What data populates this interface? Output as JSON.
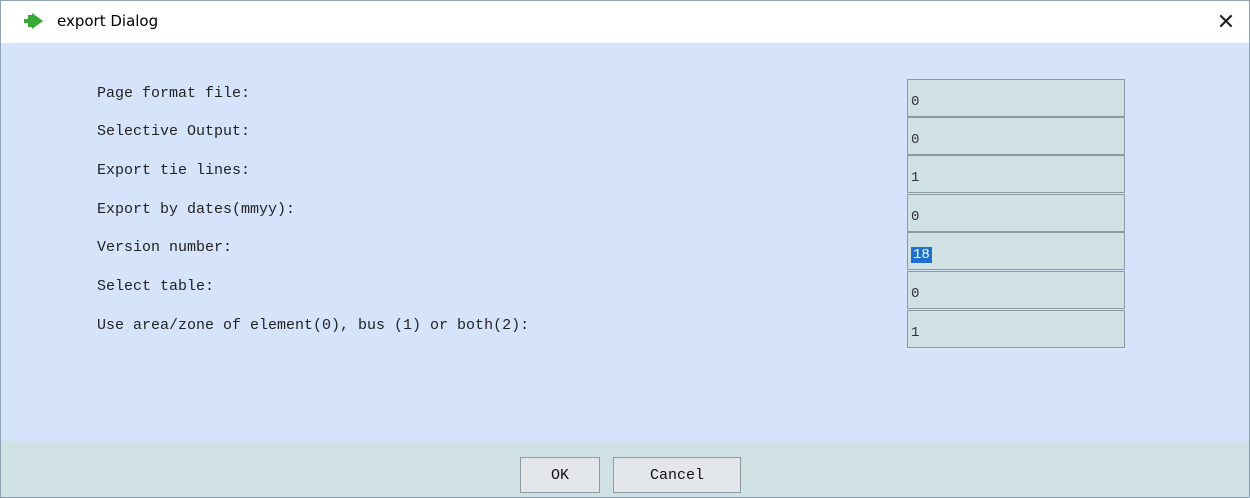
{
  "window": {
    "title": "export Dialog",
    "icon": "green-arrow-icon"
  },
  "fields": [
    {
      "label": "Page format file:",
      "value": "0"
    },
    {
      "label": "Selective Output:",
      "value": "0"
    },
    {
      "label": "Export tie lines:",
      "value": "1"
    },
    {
      "label": "Export by dates(mmyy):",
      "value": "0"
    },
    {
      "label": "Version number:",
      "value": "18"
    },
    {
      "label": "Select table:",
      "value": "0"
    },
    {
      "label": "Use area/zone of element(0), bus (1) or both(2):",
      "value": "1"
    }
  ],
  "buttons": {
    "ok": "OK",
    "cancel": "Cancel"
  },
  "colors": {
    "content_bg": "#d6e4fb",
    "field_bg": "#cfe1e3",
    "selection": "#1e6fcf"
  }
}
